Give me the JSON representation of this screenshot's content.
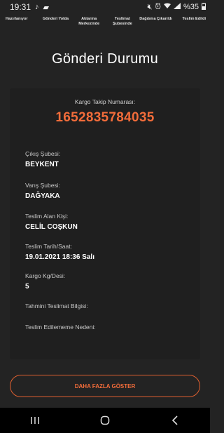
{
  "status_bar": {
    "time": "19:31",
    "battery": "%35",
    "icons": [
      "music-note-icon",
      "chat-icon",
      "mute-icon",
      "alarm-icon",
      "wifi-icon",
      "signal-icon",
      "battery-icon"
    ]
  },
  "steps": [
    "Hazırlanıyor",
    "Gönderi Yolda",
    "Aktarma Merkezinde",
    "Teslimat Şubesinde",
    "Dağıtıma Çıkarıldı",
    "Teslim Edildi"
  ],
  "title": "Gönderi Durumu",
  "card": {
    "tracking_label": "Kargo Takip Numarası:",
    "tracking_number": "1652835784035",
    "fields": [
      {
        "label": "Çıkış Şubesi:",
        "value": "BEYKENT"
      },
      {
        "label": "Varış Şubesi:",
        "value": "DAĞYAKA"
      },
      {
        "label": "Teslim Alan Kişi:",
        "value": "CELİL COŞKUN"
      },
      {
        "label": "Teslim Tarih/Saat:",
        "value": "19.01.2021 18:36 Salı"
      },
      {
        "label": "Kargo Kg/Desi:",
        "value": "5"
      },
      {
        "label": "Tahmini Teslimat Bilgisi:",
        "value": ""
      },
      {
        "label": "Teslim Edilememe Nedeni:",
        "value": ""
      }
    ]
  },
  "more_button": "DAHA FAZLA GÖSTER",
  "colors": {
    "background": "#232323",
    "card": "#1f1f1f",
    "accent": "#f26c3a"
  }
}
